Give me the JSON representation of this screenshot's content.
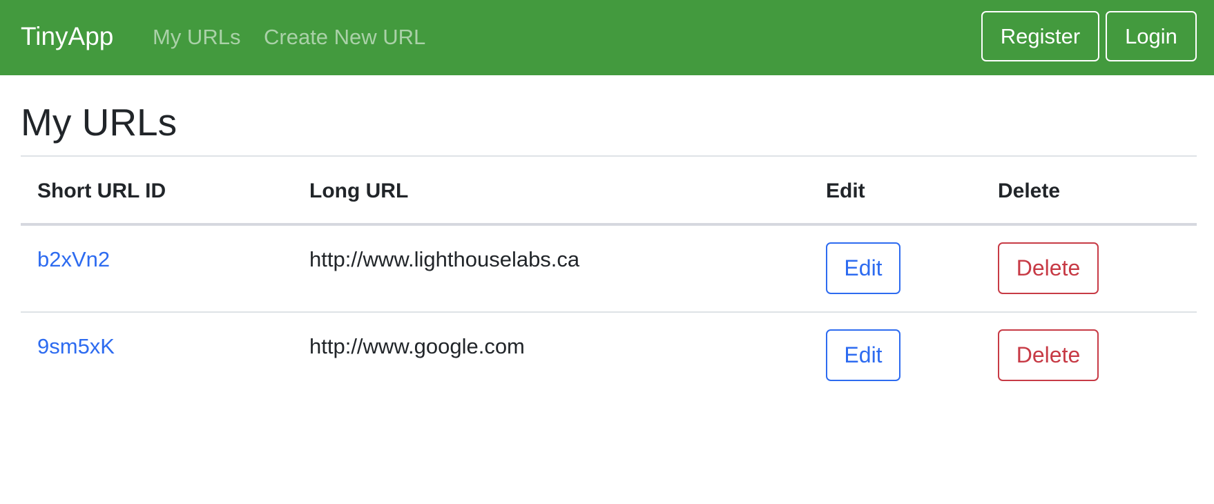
{
  "navbar": {
    "brand": "TinyApp",
    "links": [
      "My URLs",
      "Create New URL"
    ],
    "register_label": "Register",
    "login_label": "Login",
    "background_color": "#439a3e"
  },
  "page": {
    "title": "My URLs"
  },
  "table": {
    "headers": [
      "Short URL ID",
      "Long URL",
      "Edit",
      "Delete"
    ],
    "rows": [
      {
        "short_id": "b2xVn2",
        "long_url": "http://www.lighthouselabs.ca",
        "edit_label": "Edit",
        "delete_label": "Delete"
      },
      {
        "short_id": "9sm5xK",
        "long_url": "http://www.google.com",
        "edit_label": "Edit",
        "delete_label": "Delete"
      }
    ]
  },
  "colors": {
    "link": "#2d6bf0",
    "danger": "#c73a45"
  }
}
